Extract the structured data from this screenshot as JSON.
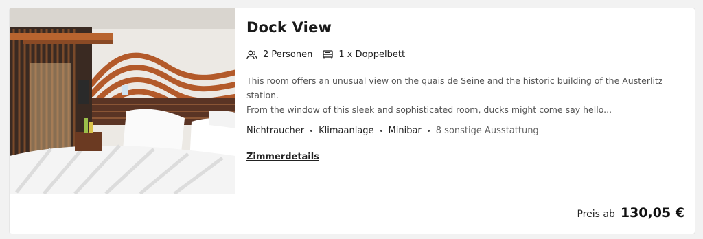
{
  "room": {
    "title": "Dock View",
    "image_alt": "Hotel room with wooden slat wall and white bed",
    "facts": [
      {
        "icon": "people-icon",
        "label": "2 Personen"
      },
      {
        "icon": "bed-icon",
        "label": "1 x Doppelbett"
      }
    ],
    "description_line1": "This room offers an unusual view on the quais de Seine and the historic building of the Austerlitz station.",
    "description_line2": "From the window of this sleek and sophisticated room, ducks might come say hello...",
    "amenities": [
      "Nichtraucher",
      "Klimaanlage",
      "Minibar"
    ],
    "amenities_more": "8 sonstige Ausstattung",
    "details_link": "Zimmerdetails"
  },
  "price": {
    "from_label": "Preis ab",
    "value": "130,05 €"
  },
  "colors": {
    "wood": "#a0522d",
    "card_bg": "#ffffff",
    "page_bg": "#f2f2f2"
  }
}
